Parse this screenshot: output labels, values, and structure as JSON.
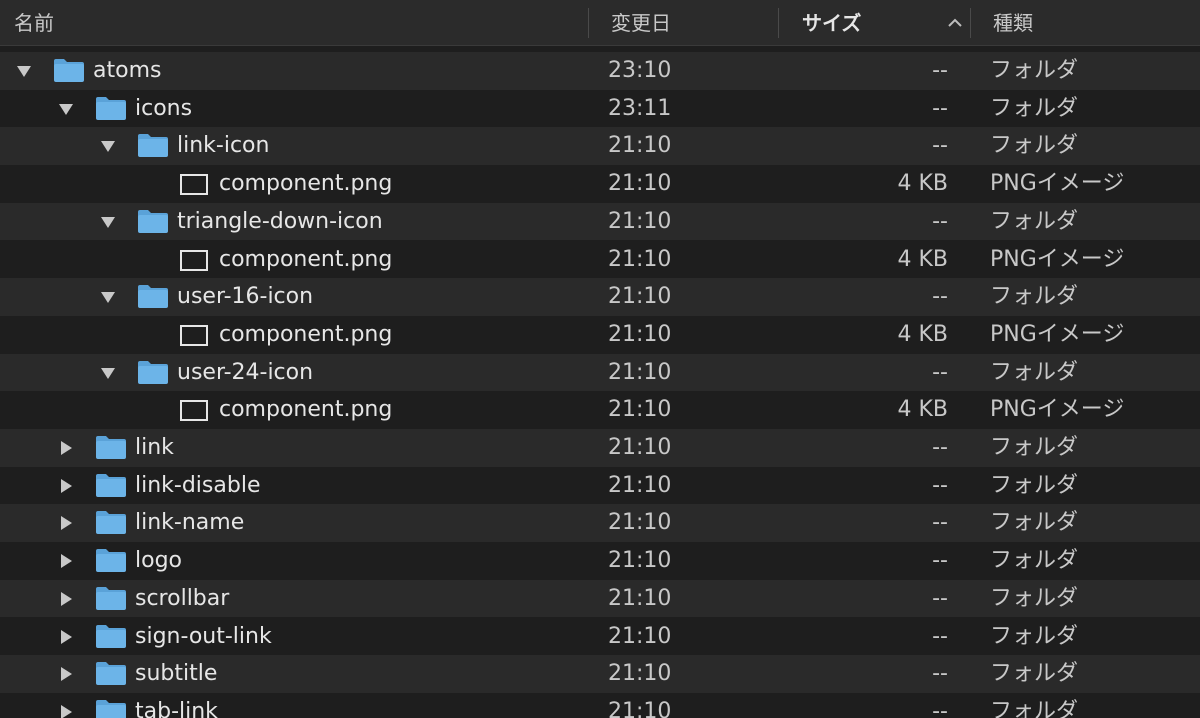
{
  "header": {
    "columns": [
      {
        "key": "name",
        "label": "名前"
      },
      {
        "key": "date",
        "label": "変更日"
      },
      {
        "key": "size",
        "label": "サイズ",
        "sorted": true
      },
      {
        "key": "kind",
        "label": "種類"
      }
    ],
    "sort_icon": "chevron-up-icon"
  },
  "colors": {
    "folder": "#6cb4e8",
    "folder_tab": "#5aa2d8",
    "row_alt": "#2a2a2a",
    "row_base": "#1e1e1e"
  },
  "rows": [
    {
      "name": "atoms",
      "date": "23:10",
      "size": "--",
      "kind": "フォルダ",
      "type": "folder",
      "depth": 0,
      "expanded": true
    },
    {
      "name": "icons",
      "date": "23:11",
      "size": "--",
      "kind": "フォルダ",
      "type": "folder",
      "depth": 1,
      "expanded": true
    },
    {
      "name": "link-icon",
      "date": "21:10",
      "size": "--",
      "kind": "フォルダ",
      "type": "folder",
      "depth": 2,
      "expanded": true
    },
    {
      "name": "component.png",
      "date": "21:10",
      "size": "4 KB",
      "kind": "PNGイメージ",
      "type": "file",
      "depth": 3
    },
    {
      "name": "triangle-down-icon",
      "date": "21:10",
      "size": "--",
      "kind": "フォルダ",
      "type": "folder",
      "depth": 2,
      "expanded": true
    },
    {
      "name": "component.png",
      "date": "21:10",
      "size": "4 KB",
      "kind": "PNGイメージ",
      "type": "file",
      "depth": 3
    },
    {
      "name": "user-16-icon",
      "date": "21:10",
      "size": "--",
      "kind": "フォルダ",
      "type": "folder",
      "depth": 2,
      "expanded": true
    },
    {
      "name": "component.png",
      "date": "21:10",
      "size": "4 KB",
      "kind": "PNGイメージ",
      "type": "file",
      "depth": 3
    },
    {
      "name": "user-24-icon",
      "date": "21:10",
      "size": "--",
      "kind": "フォルダ",
      "type": "folder",
      "depth": 2,
      "expanded": true
    },
    {
      "name": "component.png",
      "date": "21:10",
      "size": "4 KB",
      "kind": "PNGイメージ",
      "type": "file",
      "depth": 3
    },
    {
      "name": "link",
      "date": "21:10",
      "size": "--",
      "kind": "フォルダ",
      "type": "folder",
      "depth": 1,
      "expanded": false
    },
    {
      "name": "link-disable",
      "date": "21:10",
      "size": "--",
      "kind": "フォルダ",
      "type": "folder",
      "depth": 1,
      "expanded": false
    },
    {
      "name": "link-name",
      "date": "21:10",
      "size": "--",
      "kind": "フォルダ",
      "type": "folder",
      "depth": 1,
      "expanded": false
    },
    {
      "name": "logo",
      "date": "21:10",
      "size": "--",
      "kind": "フォルダ",
      "type": "folder",
      "depth": 1,
      "expanded": false
    },
    {
      "name": "scrollbar",
      "date": "21:10",
      "size": "--",
      "kind": "フォルダ",
      "type": "folder",
      "depth": 1,
      "expanded": false
    },
    {
      "name": "sign-out-link",
      "date": "21:10",
      "size": "--",
      "kind": "フォルダ",
      "type": "folder",
      "depth": 1,
      "expanded": false
    },
    {
      "name": "subtitle",
      "date": "21:10",
      "size": "--",
      "kind": "フォルダ",
      "type": "folder",
      "depth": 1,
      "expanded": false
    },
    {
      "name": "tab-link",
      "date": "21:10",
      "size": "--",
      "kind": "フォルダ",
      "type": "folder",
      "depth": 1,
      "expanded": false
    }
  ]
}
